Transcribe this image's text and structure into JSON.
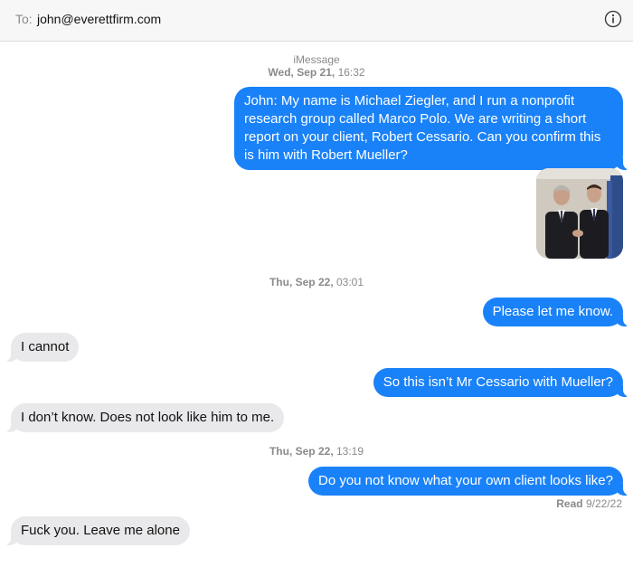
{
  "header": {
    "to_label": "To:",
    "recipient": "john@everettfirm.com",
    "info_icon": "info-circle-icon"
  },
  "thread": {
    "service": "iMessage",
    "groups": [
      {
        "day": "Wed, Sep 21,",
        "time": "16:32"
      },
      {
        "day": "Thu, Sep 22,",
        "time": "03:01"
      },
      {
        "day": "Thu, Sep 22,",
        "time": "13:19"
      }
    ],
    "messages": [
      {
        "direction": "outgoing",
        "text": "John: My name is Michael Ziegler, and I run a nonprofit research group called Marco Polo. We are writing a short report on your client, Robert Cessario. Can you confirm this is him with Robert Mueller?"
      },
      {
        "direction": "outgoing",
        "kind": "photo",
        "text": ""
      },
      {
        "direction": "outgoing",
        "text": "Please let me know."
      },
      {
        "direction": "incoming",
        "text": "I cannot"
      },
      {
        "direction": "outgoing",
        "text": "So this isn’t Mr Cessario with Mueller?"
      },
      {
        "direction": "incoming",
        "text": "I don’t know. Does not look like him to me."
      },
      {
        "direction": "outgoing",
        "text": "Do you not know what your own client looks like?"
      },
      {
        "direction": "incoming",
        "text": "Fuck you. Leave me alone"
      }
    ],
    "read_receipt": {
      "label": "Read",
      "date": "9/22/22"
    }
  },
  "colors": {
    "outgoing_bubble": "#1a82f8",
    "incoming_bubble": "#e9e9eb",
    "meta_text": "#8a8a8a",
    "header_bg": "#f7f7f7"
  }
}
